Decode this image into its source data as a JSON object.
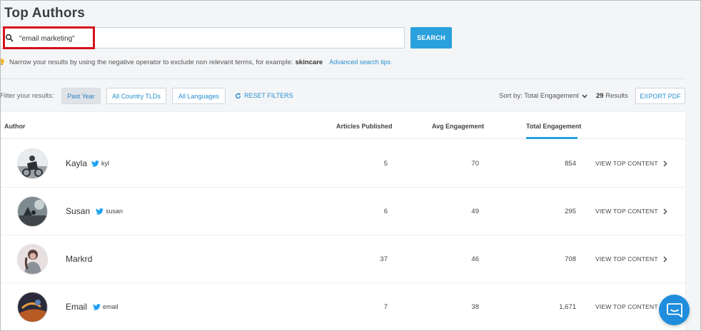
{
  "page": {
    "title": "Top Authors"
  },
  "search": {
    "value": "\"email marketing\"",
    "button_label": "SEARCH"
  },
  "hint": {
    "text": "Narrow your results by using the negative operator to exclude non relevant terms, for example:",
    "example": "skincare",
    "link": "Advanced search tips"
  },
  "filters": {
    "label": "Filter your results:",
    "chips": [
      "Past Year",
      "All Country TLDs",
      "All Languages"
    ],
    "reset_label": "RESET FILTERS"
  },
  "sort": {
    "label": "Sort by: Total Engagement"
  },
  "results": {
    "count": "29",
    "label": "Results"
  },
  "export_label": "EXPORT PDF",
  "table": {
    "headers": {
      "author": "Author",
      "articles": "Articles Published",
      "avg": "Avg Engagement",
      "total": "Total Engagement"
    },
    "rows": [
      {
        "name": "Kayla",
        "handle": "kyl",
        "articles": "5",
        "avg": "70",
        "total": "854",
        "action": "VIEW TOP CONTENT"
      },
      {
        "name": "Susan",
        "handle": "susan",
        "articles": "6",
        "avg": "49",
        "total": "295",
        "action": "VIEW TOP CONTENT"
      },
      {
        "name": "Markrd",
        "handle": "",
        "articles": "37",
        "avg": "46",
        "total": "708",
        "action": "VIEW TOP CONTENT"
      },
      {
        "name": "Email",
        "handle": "email",
        "articles": "7",
        "avg": "38",
        "total": "1,671",
        "action": "VIEW TOP CONTENT"
      }
    ]
  },
  "colors": {
    "accent": "#2aa0dc",
    "link": "#2a8fd0",
    "highlight": "#d4101b",
    "twitter": "#1da1f2",
    "chat": "#1f8ddb"
  },
  "icons": {
    "search": "search-icon",
    "hint": "lightbulb-icon",
    "reset": "refresh-icon",
    "sort": "chevron-down-icon",
    "twitter": "twitter-icon",
    "row_action": "chevron-right-icon",
    "chat": "chat-icon"
  }
}
